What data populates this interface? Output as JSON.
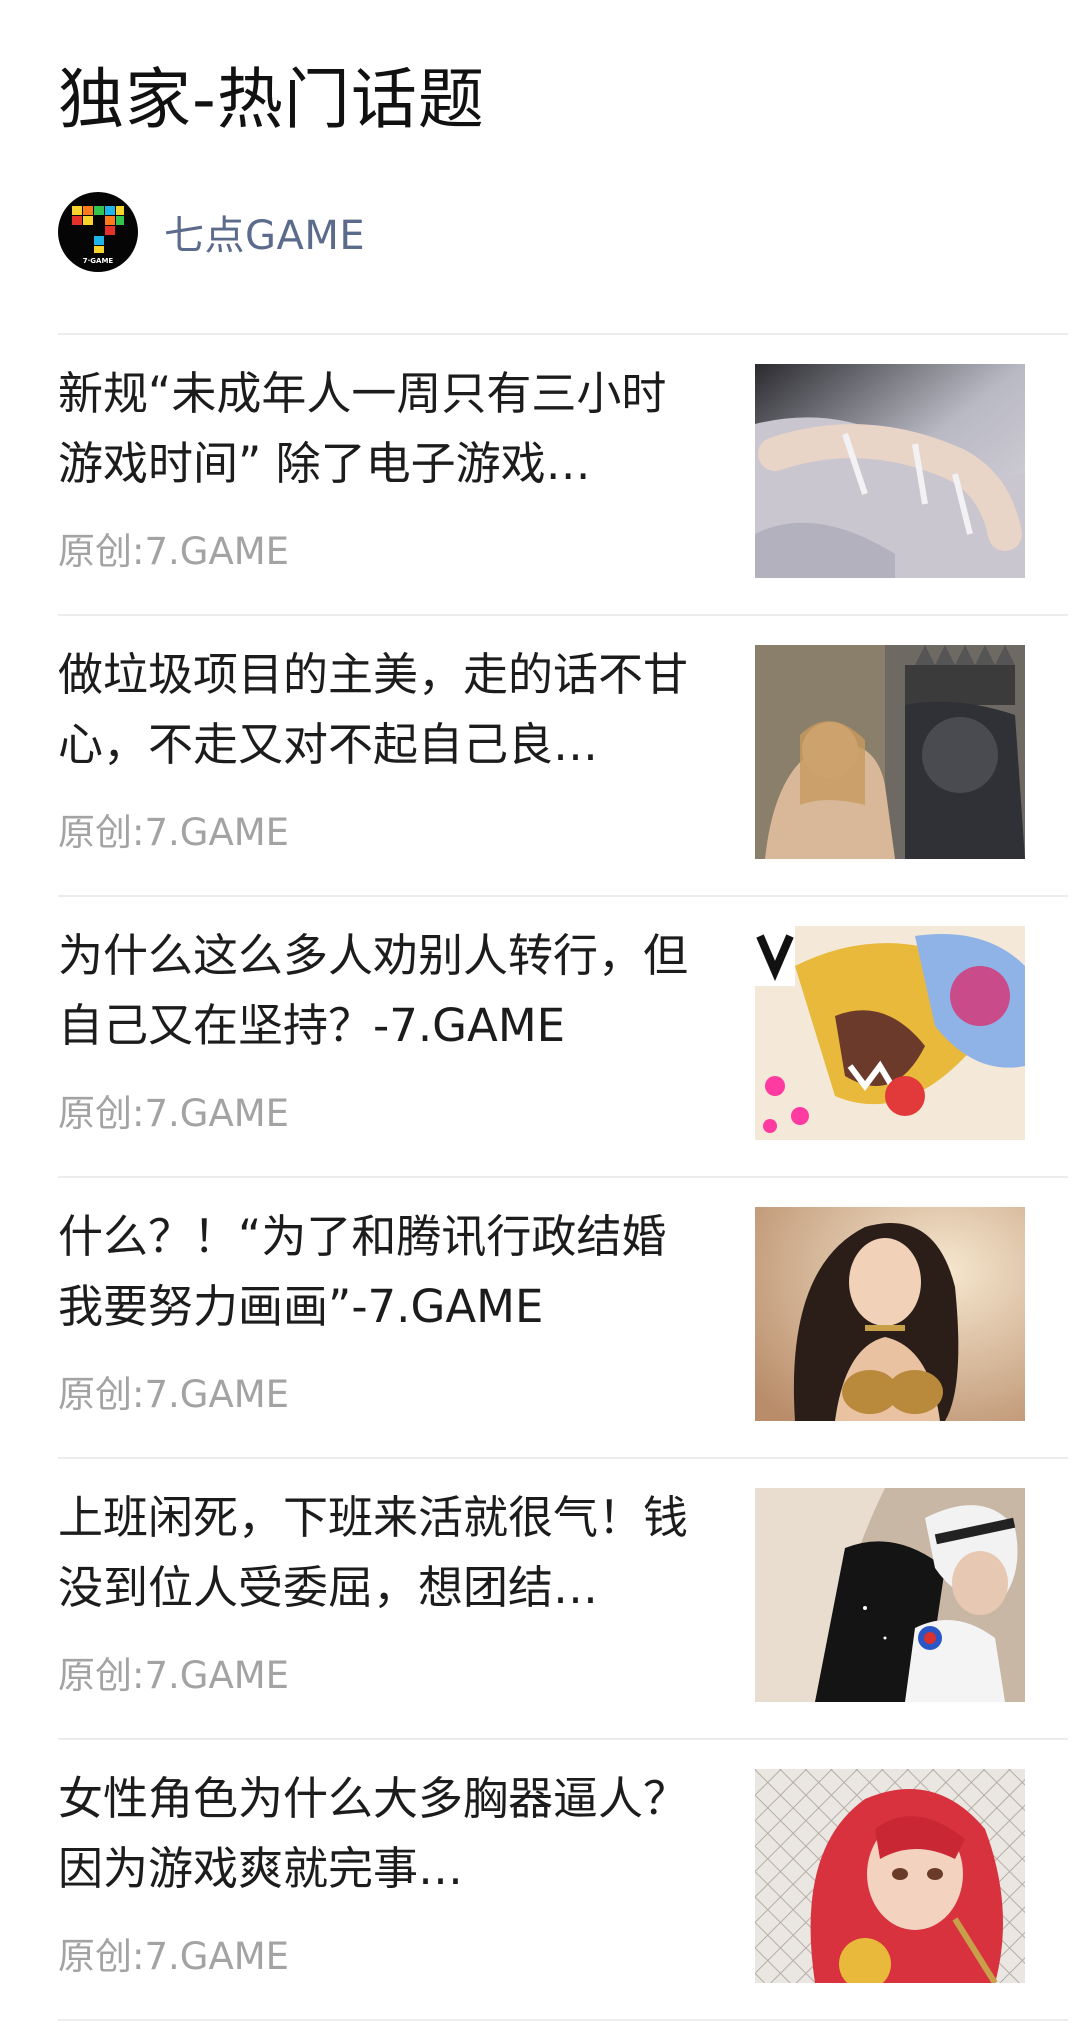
{
  "header": {
    "title": "独家-热门话题"
  },
  "account": {
    "name": "七点GAME",
    "avatar_text": "7·GAME"
  },
  "articles": [
    {
      "title": "新规“未成年人一周只有三小时游戏时间” 除了电子游戏…",
      "source": "原创:7.GAME",
      "thumb": "illustrated-figure-with-straps"
    },
    {
      "title": "做垃圾项目的主美，走的话不甘心，不走又对不起自己良…",
      "source": "原创:7.GAME",
      "thumb": "girl-and-crowned-king"
    },
    {
      "title": "为什么这么多人劝别人转行，但自己又在坚持？-7.GAME",
      "source": "原创:7.GAME",
      "thumb": "colorful-comic-creature"
    },
    {
      "title": "什么？！“为了和腾讯行政结婚我要努力画画”-7.GAME",
      "source": "原创:7.GAME",
      "thumb": "dark-haired-woman-gold-armor"
    },
    {
      "title": "上班闲死，下班来活就很气！钱没到位人受委屈，想团结…",
      "source": "原创:7.GAME",
      "thumb": "white-haired-fighter"
    },
    {
      "title": "女性角色为什么大多胸器逼人？因为游戏爽就完事…",
      "source": "原创:7.GAME",
      "thumb": "red-haired-girl-fence"
    }
  ]
}
